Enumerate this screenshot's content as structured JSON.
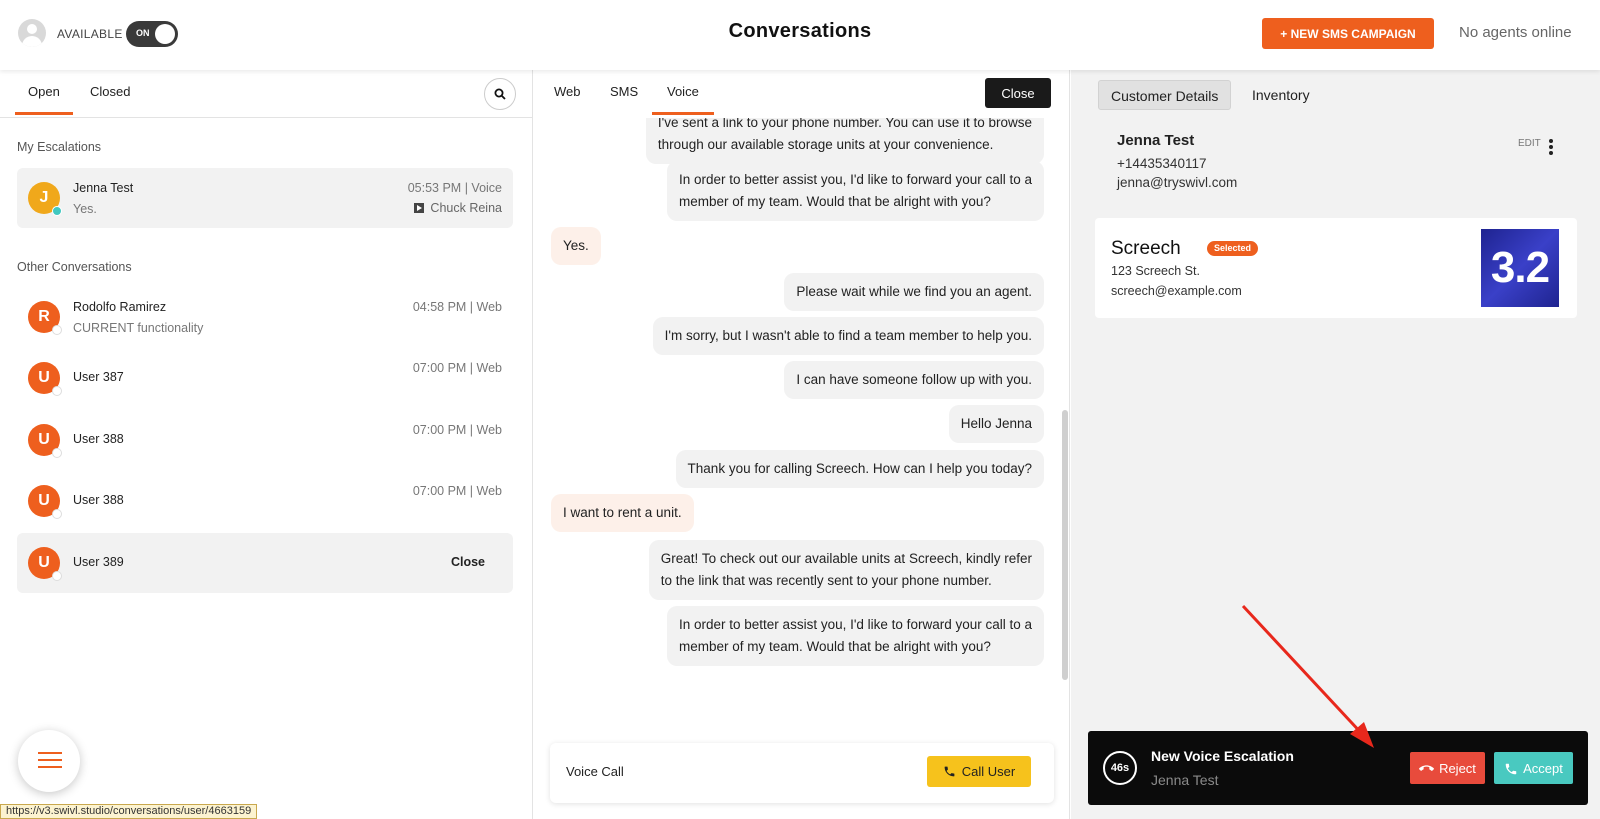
{
  "header": {
    "availability_label": "AVAILABLE",
    "toggle_label": "ON",
    "title": "Conversations",
    "sms_campaign_button": "+ NEW SMS CAMPAIGN",
    "agents_status": "No agents online"
  },
  "left": {
    "tabs": [
      {
        "label": "Open"
      },
      {
        "label": "Closed"
      }
    ],
    "my_escalations_label": "My Escalations",
    "other_conversations_label": "Other Conversations",
    "escalations": [
      {
        "initial": "J",
        "name": "Jenna Test",
        "preview": "Yes.",
        "time": "05:53 PM | Voice",
        "agent": "Chuck Reina"
      }
    ],
    "conversations": [
      {
        "initial": "R",
        "name": "Rodolfo Ramirez",
        "preview": "CURRENT functionality",
        "time": "04:58 PM | Web"
      },
      {
        "initial": "U",
        "name": "User 387",
        "preview": "",
        "time": "07:00 PM | Web"
      },
      {
        "initial": "U",
        "name": "User 388",
        "preview": "",
        "time": "07:00 PM | Web"
      },
      {
        "initial": "U",
        "name": "User 388",
        "preview": "",
        "time": "07:00 PM | Web"
      },
      {
        "initial": "U",
        "name": "User 389",
        "preview": "",
        "time": "",
        "action": "Close"
      }
    ],
    "status_url": "https://v3.swivl.studio/conversations/user/4663159"
  },
  "middle": {
    "tabs": [
      {
        "label": "Web"
      },
      {
        "label": "SMS"
      },
      {
        "label": "Voice"
      }
    ],
    "close_button": "Close",
    "messages": [
      {
        "dir": "out",
        "lines": [
          "I've sent a link to your phone number. You can use it to browse",
          "through our available storage units at your convenience."
        ]
      },
      {
        "dir": "out",
        "lines": [
          "In order to better assist you, I'd like to forward your call to a",
          "member of my team. Would that be alright with you?"
        ]
      },
      {
        "dir": "in",
        "lines": [
          "Yes."
        ]
      },
      {
        "dir": "out",
        "lines": [
          "Please wait while we find you an agent."
        ]
      },
      {
        "dir": "out",
        "lines": [
          "I'm sorry, but I wasn't able to find a team member to help you."
        ]
      },
      {
        "dir": "out",
        "lines": [
          "I can have someone follow up with you."
        ]
      },
      {
        "dir": "out",
        "lines": [
          "Hello Jenna"
        ]
      },
      {
        "dir": "out",
        "lines": [
          "Thank you for calling Screech. How can I help you today?"
        ]
      },
      {
        "dir": "in",
        "lines": [
          "I want to rent a unit."
        ]
      },
      {
        "dir": "out",
        "lines": [
          "Great! To check out our available units at Screech, kindly refer",
          "to the link that was recently sent to your phone number."
        ]
      },
      {
        "dir": "out",
        "lines": [
          "In order to better assist you, I'd like to forward your call to a",
          "member of my team. Would that be alright with you?"
        ]
      }
    ],
    "composer_label": "Voice Call",
    "call_button": "Call User"
  },
  "right": {
    "tabs": [
      {
        "label": "Customer Details"
      },
      {
        "label": "Inventory"
      }
    ],
    "customer": {
      "name": "Jenna Test",
      "phone": "+14435340117",
      "email": "jenna@tryswivl.com",
      "edit_label": "EDIT"
    },
    "inventory": {
      "name": "Screech",
      "badge": "Selected",
      "address": "123 Screech St.",
      "email": "screech@example.com",
      "image_text": "3.2"
    }
  },
  "notification": {
    "timer": "46s",
    "title": "New Voice Escalation",
    "caller": "Jenna Test",
    "reject_label": "Reject",
    "accept_label": "Accept"
  },
  "colors": {
    "accent": "#ee5f1e",
    "call_yellow": "#f6c21c",
    "reject_red": "#e84b3c",
    "accept_teal": "#49c9c0",
    "online_teal": "#41c8c0"
  },
  "icons": [
    "user-placeholder-icon",
    "search-icon",
    "phone-icon",
    "hangup-icon",
    "kebab-menu-icon",
    "menu-icon",
    "arrow-annotation"
  ]
}
